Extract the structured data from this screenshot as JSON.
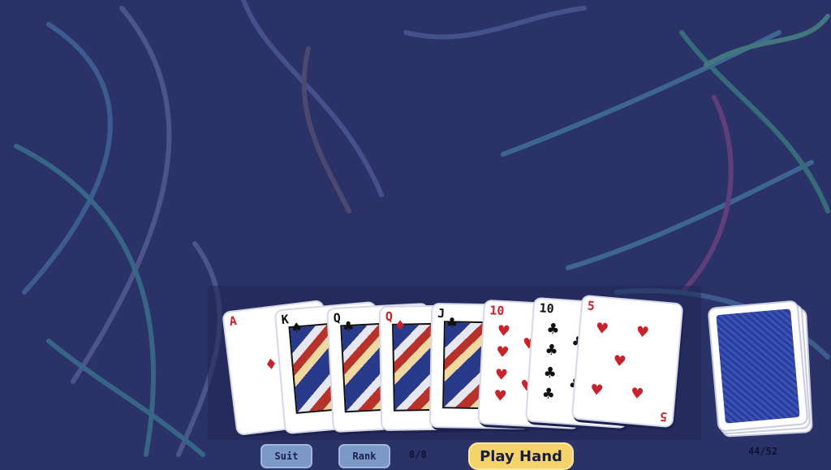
{
  "hand": [
    {
      "rank": "A",
      "suit": "♦",
      "color": "red",
      "face": false
    },
    {
      "rank": "K",
      "suit": "♠",
      "color": "black",
      "face": true
    },
    {
      "rank": "Q",
      "suit": "♣",
      "color": "black",
      "face": true
    },
    {
      "rank": "Q",
      "suit": "♦",
      "color": "red",
      "face": true
    },
    {
      "rank": "J",
      "suit": "♣",
      "color": "black",
      "face": true
    },
    {
      "rank": "10",
      "suit": "♥",
      "color": "red",
      "face": false
    },
    {
      "rank": "10",
      "suit": "♣",
      "color": "black",
      "face": false
    },
    {
      "rank": "5",
      "suit": "♥",
      "color": "red",
      "face": false
    }
  ],
  "controls": {
    "sort_suit_label": "Suit",
    "sort_rank_label": "Rank",
    "hand_count": "8/8",
    "play_label": "Play Hand",
    "deck_count": "44/52"
  },
  "colors": {
    "background": "#2b3268",
    "play_button": "#f4d36a",
    "sort_button": "#7b98c6",
    "card_back": "#3147a8"
  },
  "icons": {
    "deck": "card-back-icon"
  }
}
